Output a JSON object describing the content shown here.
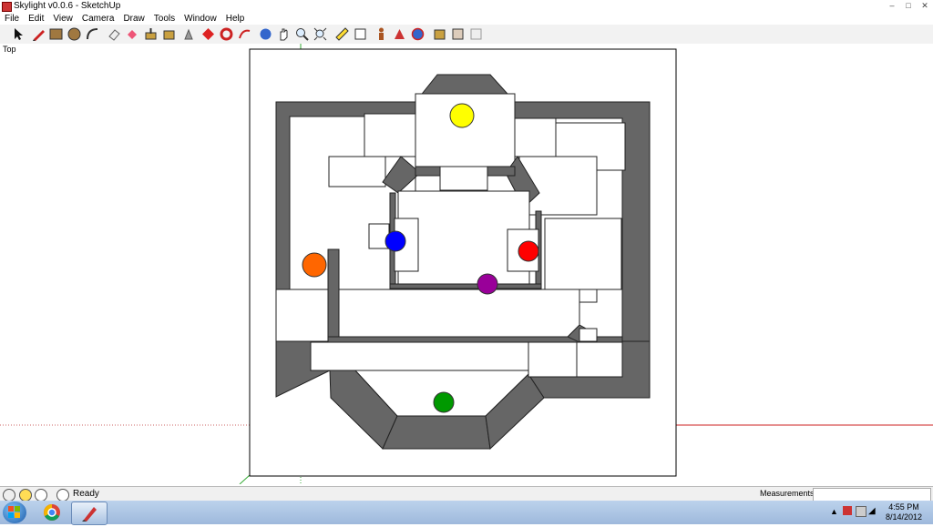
{
  "window": {
    "title": "Skylight v0.0.6 - SketchUp"
  },
  "menu": [
    "File",
    "Edit",
    "View",
    "Camera",
    "Draw",
    "Tools",
    "Window",
    "Help"
  ],
  "toolbar_icons": [
    "select-icon",
    "pencil-icon",
    "rectangle-icon",
    "circle-icon",
    "arc-icon",
    "eraser-icon",
    "paint-bucket-icon",
    "push-pull-icon",
    "move-icon",
    "rotate-icon",
    "offset-icon",
    "follow-me-icon",
    "orbit-icon",
    "pan-icon",
    "zoom-icon",
    "zoom-extents-icon",
    "tape-measure-icon",
    "text-icon",
    "walk-icon",
    "look-around-icon",
    "position-camera-icon",
    "components-icon",
    "materials-icon",
    "styles-icon"
  ],
  "viewport": {
    "view_name": "Top"
  },
  "markers": [
    {
      "color": "#ffff00"
    },
    {
      "color": "#0000ff"
    },
    {
      "color": "#ff0000"
    },
    {
      "color": "#ff6600"
    },
    {
      "color": "#990099"
    },
    {
      "color": "#009900"
    }
  ],
  "statusbar": {
    "ready": "Ready",
    "measurements_label": "Measurements",
    "measurements_value": ""
  },
  "taskbar": {
    "time": "4:55 PM",
    "date": "8/14/2012"
  }
}
